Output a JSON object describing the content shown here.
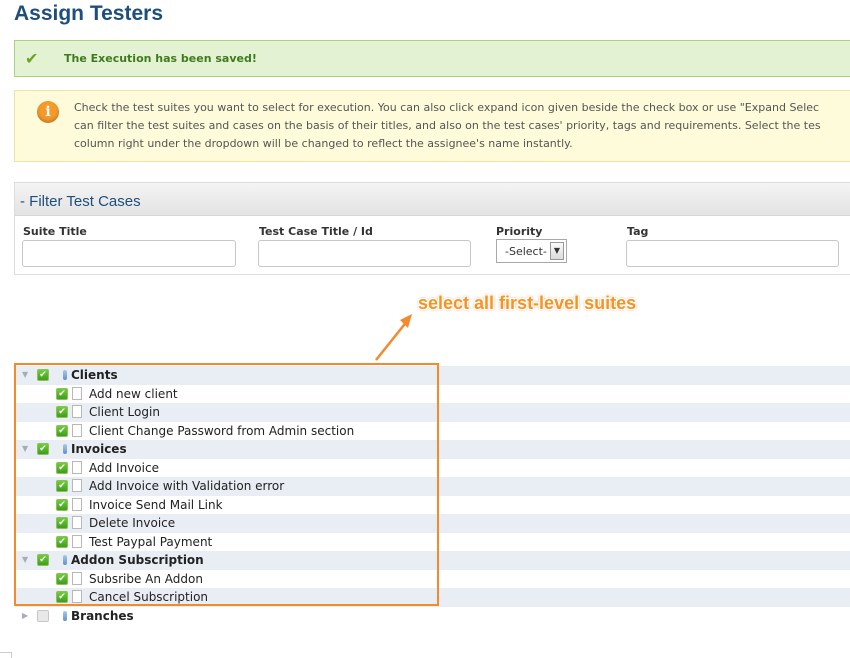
{
  "page": {
    "title": "Assign Testers"
  },
  "success": {
    "message": "The Execution has been saved!"
  },
  "info": {
    "lines": [
      "Check the test suites you want to select for execution. You can also click expand icon given beside the check box or use \"Expand Selec",
      "can filter the test suites and cases on the basis of their titles, and also on the test cases' priority, tags and requirements. Select the tes",
      "column right under the dropdown will be changed to reflect the assignee's name instantly."
    ]
  },
  "filter": {
    "title": "- Filter Test Cases",
    "suite_title_label": "Suite Title",
    "suite_title_value": "",
    "case_title_label": "Test Case Title / Id",
    "case_title_value": "",
    "priority_label": "Priority",
    "priority_selected": "-Select-",
    "tag_label": "Tag",
    "tag_value": ""
  },
  "annotation": {
    "text": "select all first-level suites"
  },
  "tree": [
    {
      "type": "suite",
      "label": "Clients",
      "checked": true,
      "expanded": true
    },
    {
      "type": "case",
      "label": "Add new client",
      "checked": true
    },
    {
      "type": "case",
      "label": "Client Login",
      "checked": true
    },
    {
      "type": "case",
      "label": "Client Change Password from Admin section",
      "checked": true
    },
    {
      "type": "suite",
      "label": "Invoices",
      "checked": true,
      "expanded": true
    },
    {
      "type": "case",
      "label": "Add Invoice",
      "checked": true
    },
    {
      "type": "case",
      "label": "Add Invoice with Validation error",
      "checked": true
    },
    {
      "type": "case",
      "label": "Invoice Send Mail Link",
      "checked": true
    },
    {
      "type": "case",
      "label": "Delete Invoice",
      "checked": true
    },
    {
      "type": "case",
      "label": "Test Paypal Payment",
      "checked": true
    },
    {
      "type": "suite",
      "label": "Addon Subscription",
      "checked": true,
      "expanded": true
    },
    {
      "type": "case",
      "label": "Subsribe An Addon",
      "checked": true
    },
    {
      "type": "case",
      "label": "Cancel Subscription",
      "checked": true
    },
    {
      "type": "suite",
      "label": "Branches",
      "checked": false,
      "expanded": false
    }
  ],
  "colors": {
    "accent": "#1d4e7c",
    "highlight": "#f28a2e",
    "success": "#e4f2d4"
  }
}
